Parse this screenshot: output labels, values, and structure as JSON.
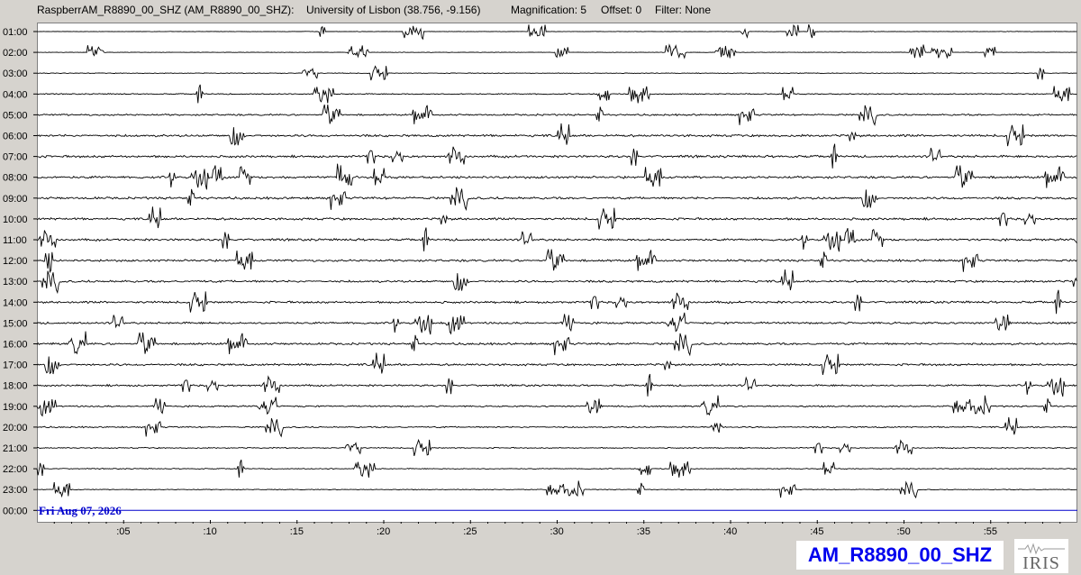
{
  "header": {
    "station": "RaspberrAM_R8890_00_SHZ (AM_R8890_00_SHZ):",
    "location": "University of Lisbon (38.756, -9.156)",
    "magnification": "Magnification: 5",
    "offset": "Offset: 0",
    "filter": "Filter: None"
  },
  "footer": {
    "station_code": "AM_R8890_00_SHZ",
    "logo_text": "IRIS"
  },
  "chart_data": {
    "type": "line",
    "title": "",
    "date_label": "Fri Aug 07, 2026",
    "hour_labels": [
      "01:00",
      "02:00",
      "03:00",
      "04:00",
      "05:00",
      "06:00",
      "07:00",
      "08:00",
      "09:00",
      "10:00",
      "11:00",
      "12:00",
      "13:00",
      "14:00",
      "15:00",
      "16:00",
      "17:00",
      "18:00",
      "19:00",
      "20:00",
      "21:00",
      "22:00",
      "23:00",
      "00:00"
    ],
    "minute_ticks": [
      ":05",
      ":10",
      ":15",
      ":20",
      ":25",
      ":30",
      ":35",
      ":40",
      ":45",
      ":50",
      ":55"
    ],
    "xlim_minutes": [
      0,
      60
    ],
    "current_trace_color": "#0000cc",
    "trace_color": "#000000",
    "trace_noise_level": [
      0.15,
      0.15,
      0.2,
      0.35,
      0.55,
      0.75,
      0.75,
      0.75,
      0.75,
      0.75,
      0.7,
      0.7,
      0.7,
      0.7,
      0.65,
      0.7,
      0.7,
      0.6,
      0.5,
      0.45,
      0.35,
      0.3,
      0.25,
      0
    ]
  }
}
